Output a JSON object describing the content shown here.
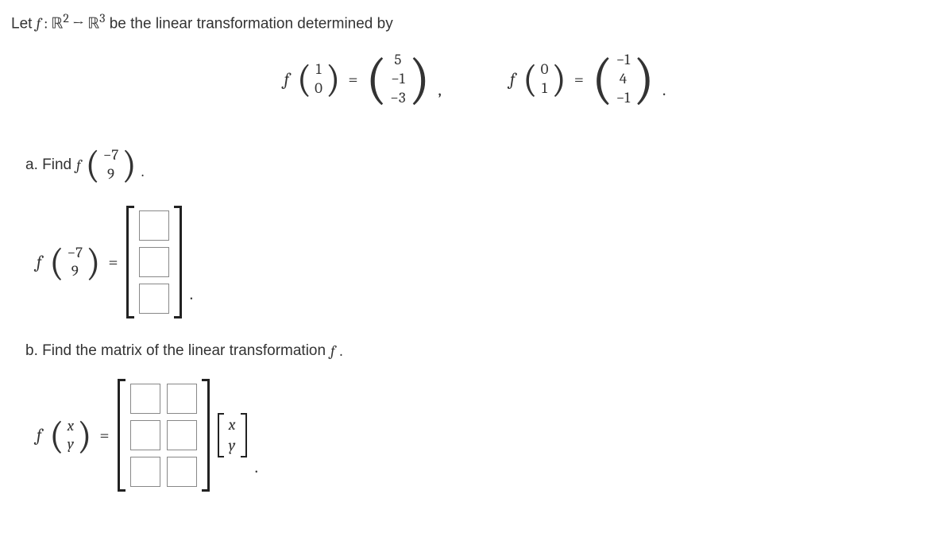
{
  "intro": {
    "prefix": "Let ",
    "f": "f",
    "colon": " : ",
    "R": "ℝ",
    "exp2": "2",
    "arrow": " → ",
    "exp3": "3",
    "tail": " be the linear transformation determined by"
  },
  "eq1": {
    "f": "f",
    "in": {
      "r1": "1",
      "r2": "0"
    },
    "eq": "=",
    "out": {
      "r1": "5",
      "r2": "−1",
      "r3": "−3"
    },
    "comma": ","
  },
  "eq2": {
    "f": "f",
    "in": {
      "r1": "0",
      "r2": "1"
    },
    "eq": "=",
    "out": {
      "r1": "−1",
      "r2": "4",
      "r3": "−1"
    },
    "period": "."
  },
  "partA": {
    "label": "a. Find ",
    "f": "f",
    "vec": {
      "r1": "−7",
      "r2": "9"
    },
    "period": "."
  },
  "ansA": {
    "f": "f",
    "vec": {
      "r1": "−7",
      "r2": "9"
    },
    "eq": "=",
    "period": "."
  },
  "partB": {
    "text": "b. Find the matrix of the linear transformation ",
    "f": "f",
    "period": "."
  },
  "ansB": {
    "f": "f",
    "vec": {
      "r1": "x",
      "r2": "y"
    },
    "eq": "=",
    "xvec": {
      "r1": "x",
      "r2": "y"
    },
    "period": "."
  }
}
